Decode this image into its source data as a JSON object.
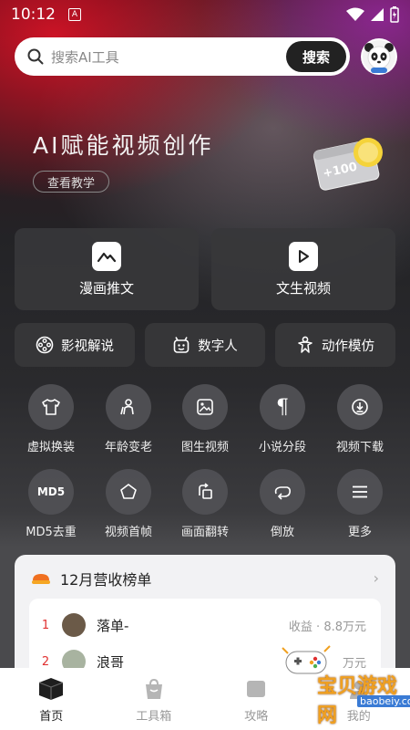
{
  "status": {
    "time": "10:12",
    "notif_letter": "A"
  },
  "search": {
    "placeholder": "搜索AI工具",
    "button": "搜索"
  },
  "hero": {
    "title": "AI赋能视频创作",
    "tutorial": "查看教学",
    "badge": "+100"
  },
  "big_cards": [
    {
      "label": "漫画推文",
      "icon": "mountain-icon"
    },
    {
      "label": "文生视频",
      "icon": "play-icon"
    }
  ],
  "mid_cards": [
    {
      "label": "影视解说",
      "icon": "film-reel-icon"
    },
    {
      "label": "数字人",
      "icon": "robot-face-icon"
    },
    {
      "label": "动作模仿",
      "icon": "figure-icon"
    }
  ],
  "tools": [
    {
      "label": "虚拟换装",
      "icon": "shirt-icon"
    },
    {
      "label": "年龄变老",
      "icon": "person-cane-icon"
    },
    {
      "label": "图生视频",
      "icon": "image-icon"
    },
    {
      "label": "小说分段",
      "icon": "pilcrow-icon"
    },
    {
      "label": "视频下载",
      "icon": "download-icon"
    },
    {
      "label": "MD5去重",
      "icon": "md5-icon",
      "icon_text": "MD5"
    },
    {
      "label": "视频首帧",
      "icon": "pentagon-icon"
    },
    {
      "label": "画面翻转",
      "icon": "rotate-icon"
    },
    {
      "label": "倒放",
      "icon": "rewind-loop-icon"
    },
    {
      "label": "更多",
      "icon": "menu-icon"
    }
  ],
  "ranking": {
    "title": "12月营收榜单",
    "rows": [
      {
        "rank": "1",
        "name": "落单-",
        "income": "收益 · 8.8万元"
      },
      {
        "rank": "2",
        "name": "浪哥",
        "income": "万元"
      }
    ]
  },
  "tabs": [
    {
      "label": "首页",
      "icon": "box-icon",
      "active": true
    },
    {
      "label": "工具箱",
      "icon": "toolbox-icon",
      "active": false
    },
    {
      "label": "攻略",
      "icon": "guide-icon",
      "active": false
    },
    {
      "label": "我的",
      "icon": "profile-icon",
      "active": false
    }
  ],
  "watermark": {
    "text": "宝贝游戏网",
    "url": "baobeiy.com"
  },
  "colors": {
    "accent_red": "#e03030",
    "search_button": "#222222"
  }
}
